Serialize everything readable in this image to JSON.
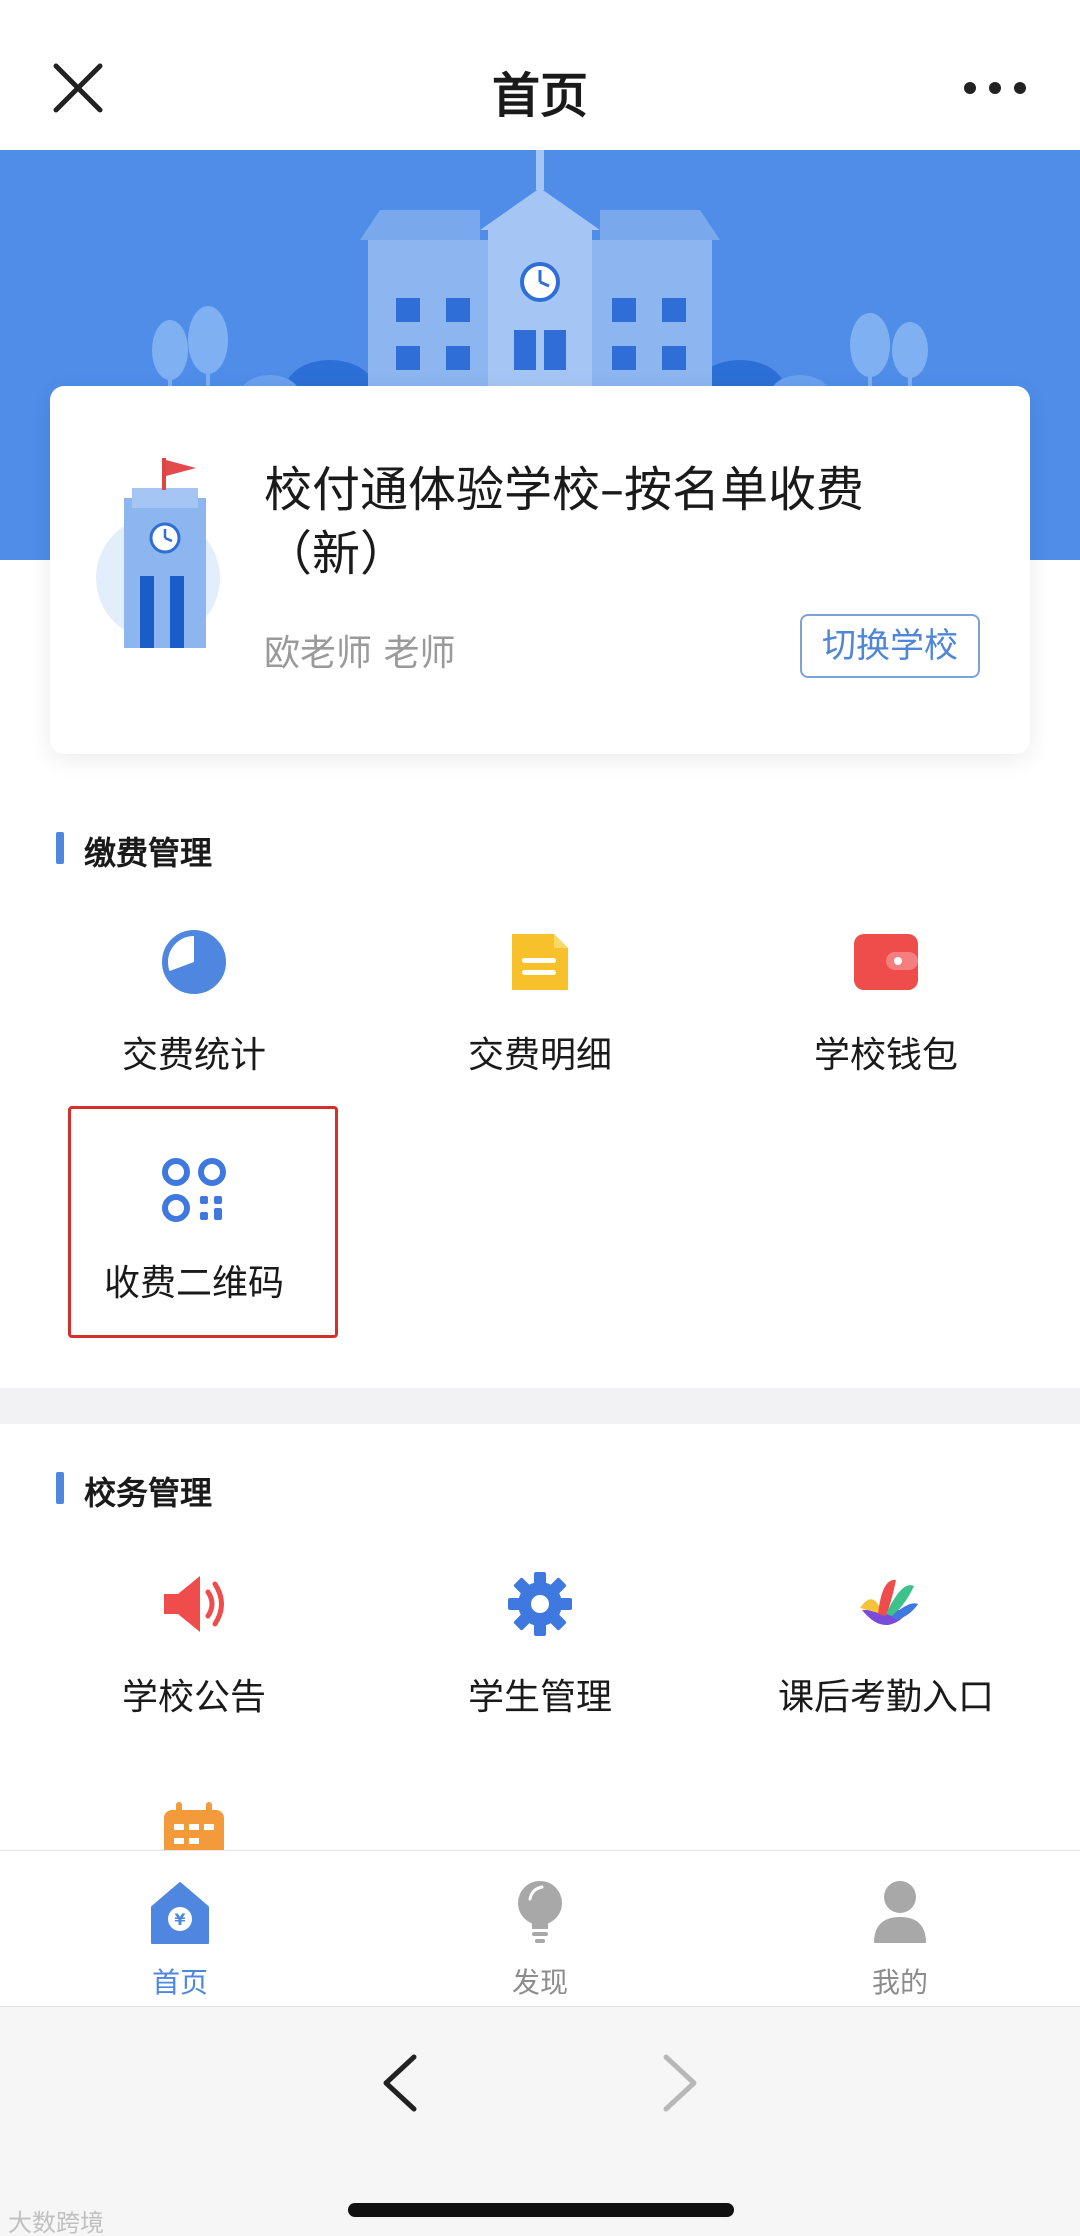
{
  "nav": {
    "title": "首页"
  },
  "school": {
    "name": "校付通体验学校–按名单收费（新）",
    "user": "欧老师  老师",
    "switch_label": "切换学校"
  },
  "payment_section": {
    "title": "缴费管理",
    "items": [
      {
        "label": "交费统计",
        "icon": "pie-chart-icon",
        "color": "#4f86e0"
      },
      {
        "label": "交费明细",
        "icon": "document-icon",
        "color": "#f7c12c"
      },
      {
        "label": "学校钱包",
        "icon": "wallet-icon",
        "color": "#ef4c4c"
      },
      {
        "label": "收费二维码",
        "icon": "qr-code-icon",
        "color": "#3f79e0"
      }
    ]
  },
  "school_section": {
    "title": "校务管理",
    "items": [
      {
        "label": "学校公告",
        "icon": "megaphone-icon",
        "color": "#ef4c4c"
      },
      {
        "label": "学生管理",
        "icon": "gear-icon",
        "color": "#3f79e0"
      },
      {
        "label": "课后考勤入口",
        "icon": "attendance-icon",
        "color": "#f5a623"
      },
      {
        "label": "",
        "icon": "calendar-icon",
        "color": "#f39a3b"
      }
    ]
  },
  "tabbar": [
    {
      "label": "首页",
      "icon": "home-yuan-icon",
      "active": true
    },
    {
      "label": "发现",
      "icon": "lightbulb-icon",
      "active": false
    },
    {
      "label": "我的",
      "icon": "user-icon",
      "active": false
    }
  ],
  "watermark": "大数跨境",
  "colors": {
    "accent": "#4f86e0",
    "banner": "#4f8de8",
    "highlight": "#d4302a"
  }
}
